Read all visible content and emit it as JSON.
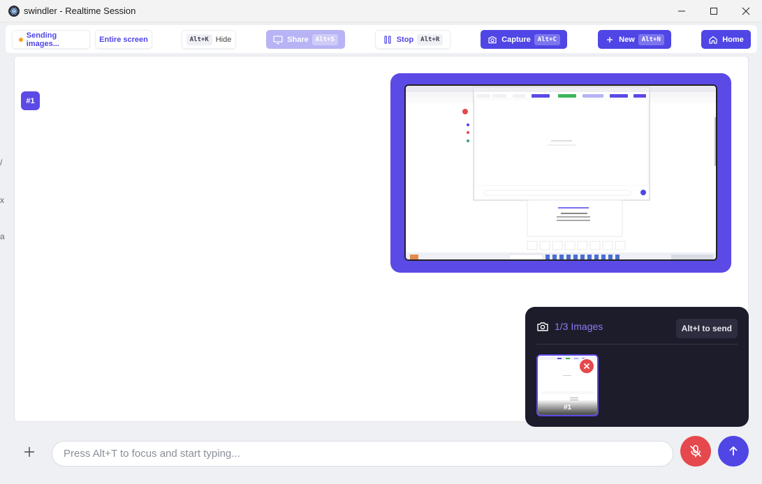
{
  "window": {
    "title": "swindler - Realtime Session"
  },
  "toolbar": {
    "sending_label": "Sending images...",
    "screen_label": "Entire screen",
    "hide_kbd": "Alt+K",
    "hide_label": "Hide",
    "share_label": "Share",
    "share_kbd": "Alt+S",
    "stop_label": "Stop",
    "stop_kbd": "Alt+R",
    "capture_label": "Capture",
    "capture_kbd": "Alt+C",
    "new_label": "New",
    "new_kbd": "Alt+N",
    "home_label": "Home"
  },
  "capture": {
    "badge": "#1"
  },
  "images_panel": {
    "count_label": "1/3 Images",
    "send_hint": "Alt+I to send",
    "thumbnails": [
      {
        "label": "#1"
      }
    ]
  },
  "composer": {
    "placeholder": "Press Alt+T to focus and start typing..."
  },
  "colors": {
    "accent": "#4f46e5",
    "accent_faded": "#b7b3f4",
    "danger": "#e5484d",
    "panel_bg": "#1c1c2b",
    "status_dot": "#f5a623"
  }
}
